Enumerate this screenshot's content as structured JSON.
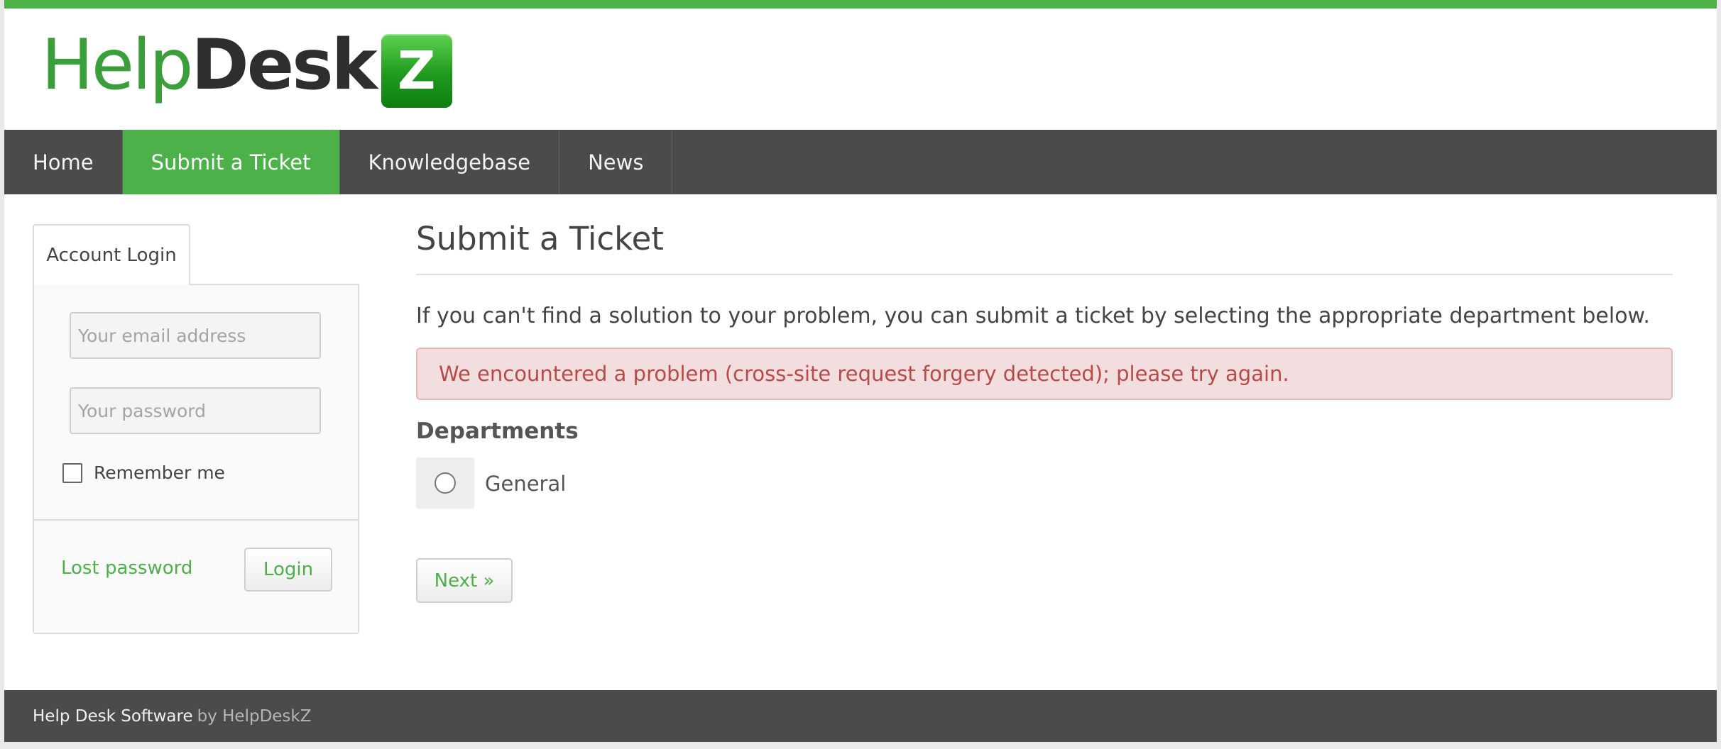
{
  "brand": {
    "logo_help": "Help",
    "logo_desk": "Desk",
    "logo_z": "Z",
    "accent_color": "#4db14a"
  },
  "nav": {
    "items": [
      {
        "label": "Home"
      },
      {
        "label": "Submit a Ticket",
        "active": true
      },
      {
        "label": "Knowledgebase"
      },
      {
        "label": "News"
      }
    ]
  },
  "sidebar": {
    "tab_label": "Account Login",
    "email_placeholder": "Your email address",
    "password_placeholder": "Your password",
    "remember_label": "Remember me",
    "lost_password": "Lost password",
    "login_button": "Login"
  },
  "main": {
    "title": "Submit a Ticket",
    "intro": "If you can't find a solution to your problem, you can submit a ticket by selecting the appropriate department below.",
    "error": "We encountered a problem (cross-site request forgery detected); please try again.",
    "departments_heading": "Departments",
    "departments": [
      {
        "label": "General"
      }
    ],
    "next_button": "Next »"
  },
  "footer": {
    "software": "Help Desk Software",
    "by": "by HelpDeskZ"
  }
}
